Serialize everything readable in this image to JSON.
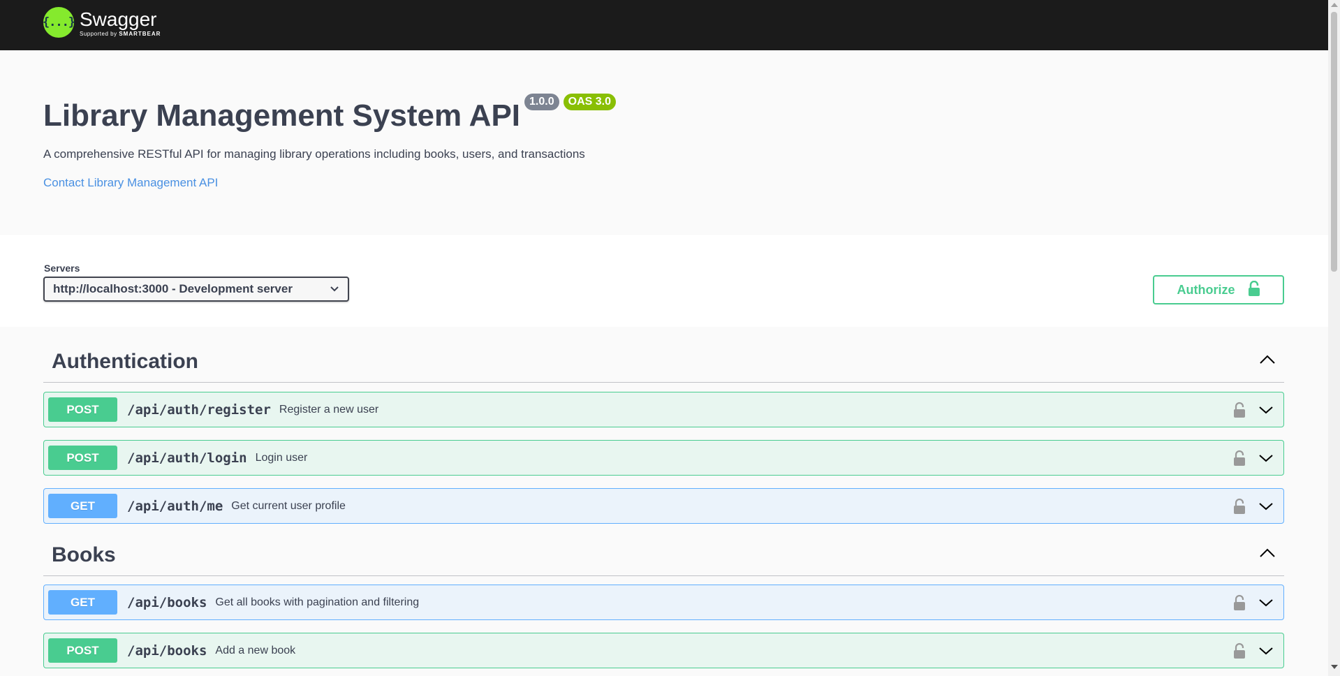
{
  "header": {
    "logo_icon": "{...}",
    "logo_name": "Swagger",
    "logo_sub_prefix": "Supported by ",
    "logo_sub_brand": "SMARTBEAR"
  },
  "info": {
    "title": "Library Management System API",
    "version": "1.0.0",
    "oas": "OAS 3.0",
    "description": "A comprehensive RESTful API for managing library operations including books, users, and transactions",
    "contact": "Contact Library Management API"
  },
  "servers": {
    "label": "Servers",
    "selected": "http://localhost:3000 - Development server"
  },
  "authorize_label": "Authorize",
  "tags": [
    {
      "name": "Authentication",
      "operations": [
        {
          "method": "POST",
          "path": "/api/auth/register",
          "summary": "Register a new user"
        },
        {
          "method": "POST",
          "path": "/api/auth/login",
          "summary": "Login user"
        },
        {
          "method": "GET",
          "path": "/api/auth/me",
          "summary": "Get current user profile"
        }
      ]
    },
    {
      "name": "Books",
      "operations": [
        {
          "method": "GET",
          "path": "/api/books",
          "summary": "Get all books with pagination and filtering"
        },
        {
          "method": "POST",
          "path": "/api/books",
          "summary": "Add a new book"
        }
      ]
    }
  ],
  "colors": {
    "post": "#49cc90",
    "get": "#61affe",
    "logo": "#85ea2d",
    "topbar": "#1b1b1b"
  },
  "icons": {
    "lock": "lock-icon",
    "unlock": "unlock-icon",
    "chevron_down": "chevron-down-icon",
    "chevron_up": "chevron-up-icon"
  }
}
